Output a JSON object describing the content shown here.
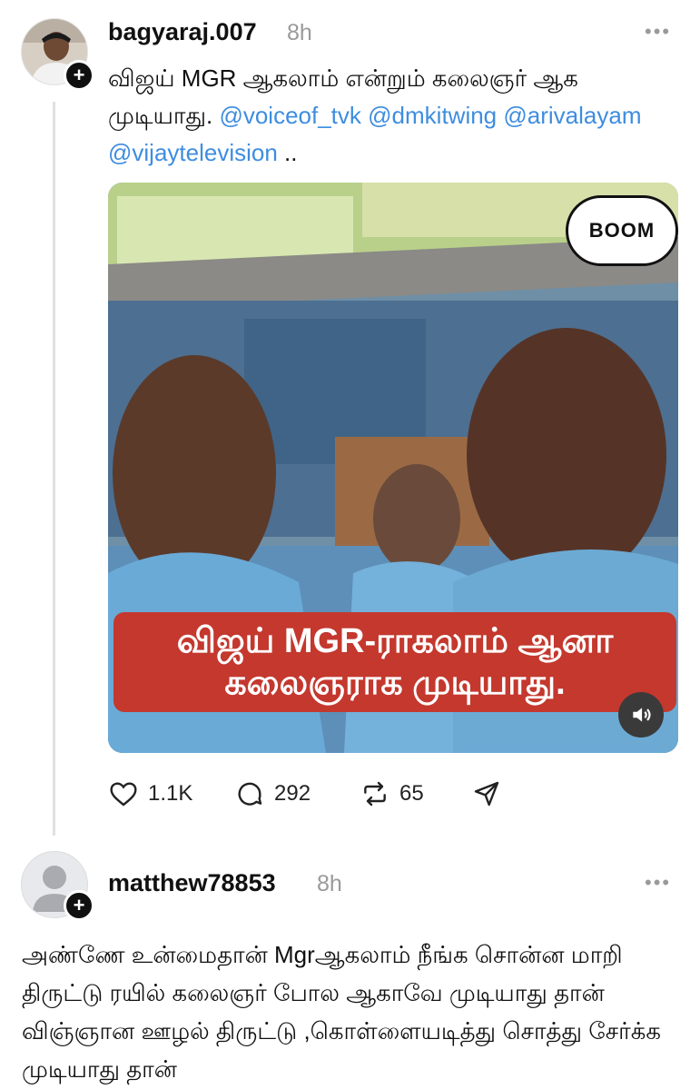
{
  "post": {
    "username": "bagyaraj.007",
    "time": "8h",
    "text_prefix": "விஜய் MGR ஆகலாம் என்றும் கலைஞர் ஆக முடியாது.",
    "mentions": [
      "@voiceof_tvk",
      "@dmkitwing",
      "@arivalayam",
      "@vijaytelevision"
    ],
    "text_suffix": "..",
    "media": {
      "badge": "BOOM",
      "caption_line1": "விஜய் MGR-ராகலாம் ஆனா",
      "caption_line2": "கலைஞராக முடியாது."
    },
    "actions": {
      "likes": "1.1K",
      "comments": "292",
      "reposts": "65"
    }
  },
  "reply": {
    "username": "matthew78853",
    "time": "8h",
    "text": "அண்ணே உன்மைதான் Mgrஆகலாம் நீங்க சொன்ன மாறி திருட்டு ரயில் கலைஞர் போல ஆகாவே முடியாது தான்  விஞ்ஞான ஊழல் திருட்டு ,கொள்ளையடித்து சொத்து சேர்க்க முடியாது தான்"
  },
  "icons": {
    "more": "more-horizontal-icon",
    "like": "heart-icon",
    "comment": "comment-icon",
    "repost": "repost-icon",
    "share": "send-icon",
    "sound": "speaker-icon",
    "follow": "plus-icon"
  },
  "colors": {
    "mention": "#3e8de0",
    "caption_bg": "#c4382e",
    "muted": "#9a9a9a"
  }
}
